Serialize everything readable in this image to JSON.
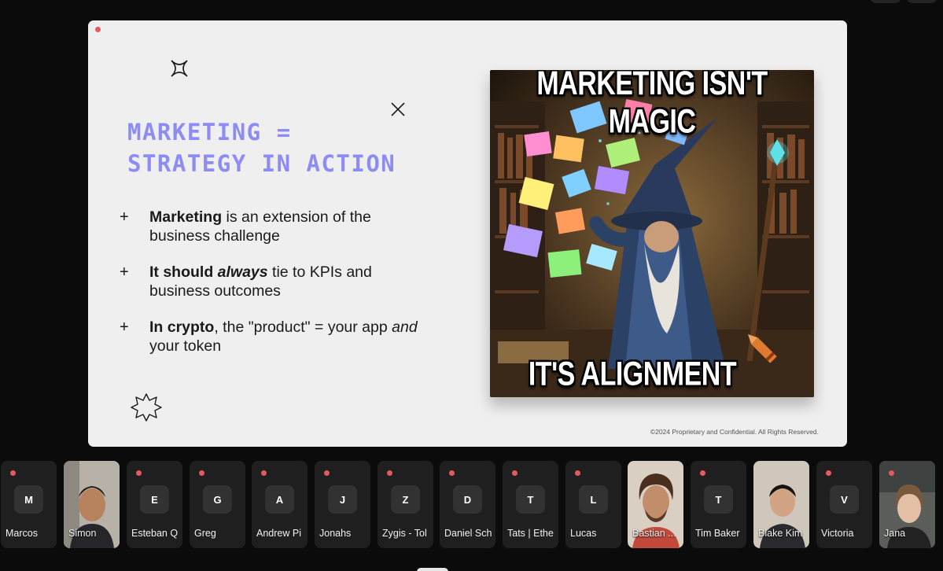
{
  "slide": {
    "title_line1": "Marketing =",
    "title_line2": "Strategy in Action",
    "bullets": [
      {
        "bold": "Marketing",
        "rest": " is an extension of the business challenge"
      },
      {
        "bold": "It should ",
        "bold_italic": "always",
        "rest": " tie to KPIs and business outcomes"
      },
      {
        "bold": "In crypto",
        "rest": ", the \"product\" = your app ",
        "italic": "and",
        "rest2": " your token"
      }
    ],
    "meme_top_text": "MARKETING ISN'T MAGIC",
    "meme_bottom_text": "IT'S ALIGNMENT",
    "footer": "©2024 Proprietary and Confidential. All Rights Reserved."
  },
  "participants": [
    {
      "initial": "M",
      "name": "Marcos",
      "video": false,
      "active": false
    },
    {
      "initial": "",
      "name": "Simon",
      "video": true,
      "active": true
    },
    {
      "initial": "E",
      "name": "Esteban Q",
      "video": false,
      "active": false
    },
    {
      "initial": "G",
      "name": "Greg",
      "video": false,
      "active": false
    },
    {
      "initial": "A",
      "name": "Andrew Pi",
      "video": false,
      "active": false
    },
    {
      "initial": "J",
      "name": "Jonahs",
      "video": false,
      "active": false
    },
    {
      "initial": "Z",
      "name": "Zygis - Tol",
      "video": false,
      "active": false
    },
    {
      "initial": "D",
      "name": "Daniel Sch",
      "video": false,
      "active": false
    },
    {
      "initial": "T",
      "name": "Tats | Ethe",
      "video": false,
      "active": false
    },
    {
      "initial": "L",
      "name": "Lucas",
      "video": false,
      "active": false
    },
    {
      "initial": "",
      "name": "Bastian ...",
      "video": true,
      "active": false
    },
    {
      "initial": "T",
      "name": "Tim Baker",
      "video": false,
      "active": false
    },
    {
      "initial": "",
      "name": "Blake Kim",
      "video": true,
      "active": false
    },
    {
      "initial": "V",
      "name": "Victoria",
      "video": false,
      "active": false
    },
    {
      "initial": "",
      "name": "Jana",
      "video": true,
      "active": true
    }
  ],
  "colors": {
    "title_accent": "#8c8cf4",
    "active_border": "#8b73f0",
    "recording_dot": "#e55b5b"
  }
}
